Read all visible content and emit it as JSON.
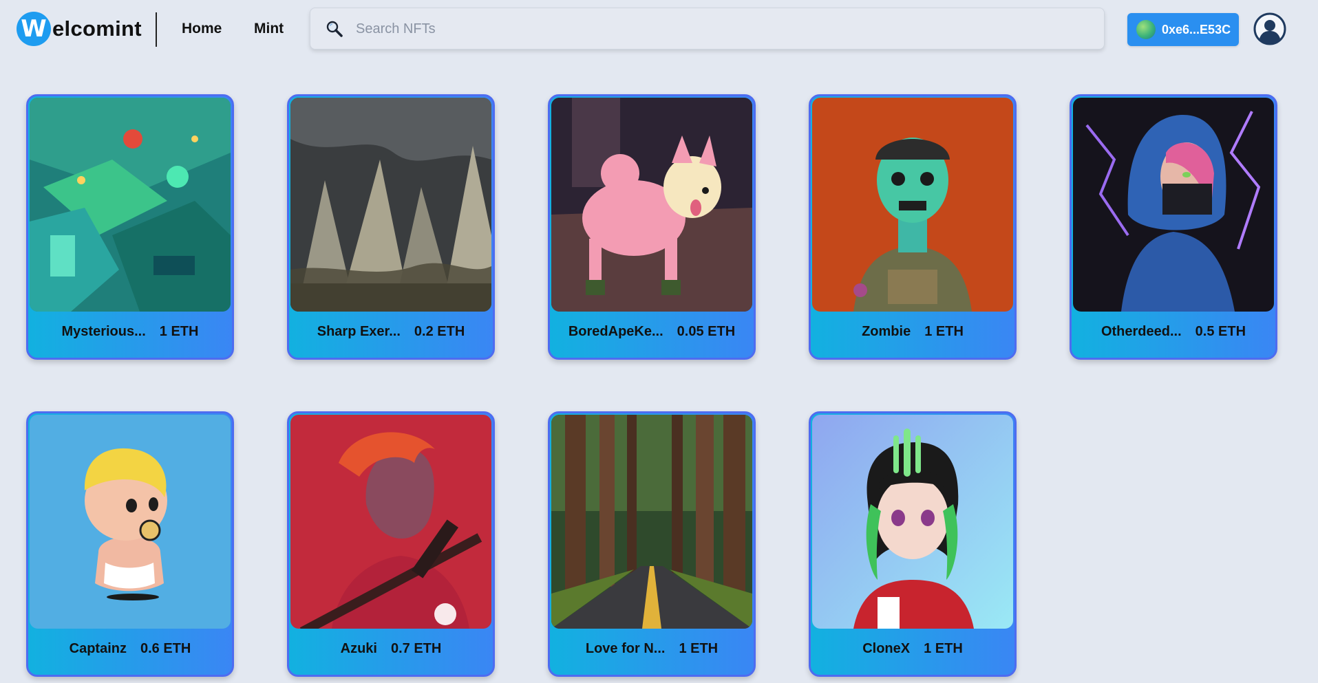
{
  "header": {
    "logo_letter": "W",
    "logo_text": "elcomint",
    "nav": {
      "home": "Home",
      "mint": "Mint"
    },
    "search_placeholder": "Search NFTs",
    "wallet_address": "0xe6...E53C"
  },
  "nfts": [
    {
      "name": "Mysterious...",
      "price": "1 ETH"
    },
    {
      "name": "Sharp Exer...",
      "price": "0.2 ETH"
    },
    {
      "name": "BoredApeKe...",
      "price": "0.05 ETH"
    },
    {
      "name": "Zombie",
      "price": "1 ETH"
    },
    {
      "name": "Otherdeed...",
      "price": "0.5 ETH"
    },
    {
      "name": "Captainz",
      "price": "0.6 ETH"
    },
    {
      "name": "Azuki",
      "price": "0.7 ETH"
    },
    {
      "name": "Love for N...",
      "price": "1 ETH"
    },
    {
      "name": "CloneX",
      "price": "1 ETH"
    }
  ],
  "colors": {
    "accent": "#2a8ff0",
    "card_border": "#4e6cf0",
    "background": "#e3e8f1"
  }
}
